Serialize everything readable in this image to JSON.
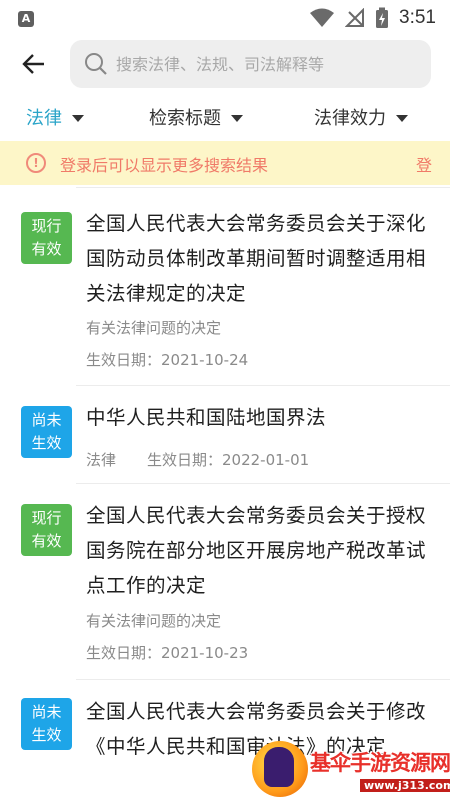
{
  "status_bar": {
    "app_icon_letter": "A",
    "time": "3:51"
  },
  "search": {
    "placeholder": "搜索法律、法规、司法解释等"
  },
  "filters": [
    {
      "label": "法律",
      "active": true
    },
    {
      "label": "检索标题",
      "active": false
    },
    {
      "label": "法律效力",
      "active": false
    }
  ],
  "notice": {
    "icon": "info-icon",
    "text": "登录后可以显示更多搜索结果",
    "overflow_text": "登"
  },
  "results": [
    {
      "status": "现行\n有效",
      "status_line1": "现行",
      "status_line2": "有效",
      "status_color": "#56b851",
      "title": "全国人民代表大会常务委员会关于深化国防动员体制改革期间暂时调整适用相关法律规定的决定",
      "category": "有关法律问题的决定",
      "date_text": "生效日期：2021-10-24"
    },
    {
      "status_line1": "尚未",
      "status_line2": "生效",
      "status_color": "#1ea5e8",
      "title": "中华人民共和国陆地国界法",
      "category": "法律",
      "date_text": "生效日期：2022-01-01"
    },
    {
      "status_line1": "现行",
      "status_line2": "有效",
      "status_color": "#56b851",
      "title": "全国人民代表大会常务委员会关于授权国务院在部分地区开展房地产税改革试点工作的决定",
      "category": "有关法律问题的决定",
      "date_text": "生效日期：2021-10-23"
    },
    {
      "status_line1": "尚未",
      "status_line2": "生效",
      "status_color": "#1ea5e8",
      "title": "全国人民代表大会常务委员会关于修改《中华人民共和国审计法》的决定"
    }
  ],
  "watermark": {
    "title": "基伞手游资源网",
    "url": "www.j313.com"
  },
  "colors": {
    "accent": "#2aa4c8",
    "notice_bg": "#fdf6c8",
    "notice_text": "#f07a68"
  }
}
